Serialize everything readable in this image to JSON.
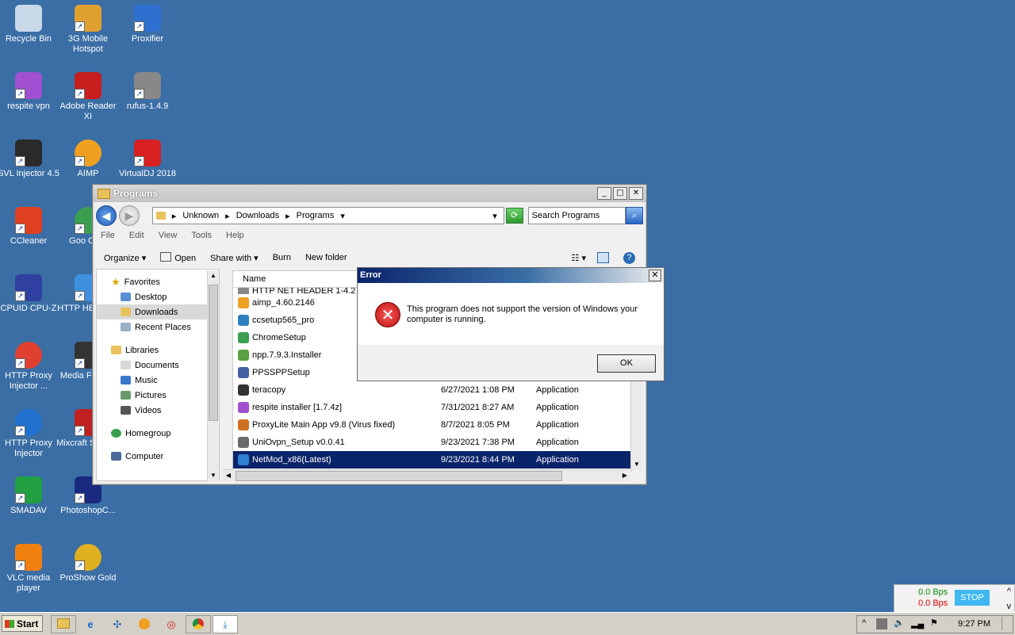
{
  "desktop": {
    "icons": [
      {
        "label": "Recycle Bin",
        "color": "#c8d8e8"
      },
      {
        "label": "3G Mobile Hotspot",
        "color": "#e0a030"
      },
      {
        "label": "Proxifier",
        "color": "#2f6fd0"
      },
      {
        "label": "respite vpn",
        "color": "#a050d0"
      },
      {
        "label": "Adobe Reader XI",
        "color": "#c81e1e"
      },
      {
        "label": "rufus-1.4.9",
        "color": "#888888"
      },
      {
        "label": "SVL Injector 4.5",
        "color": "#2a2a2a"
      },
      {
        "label": "AIMP",
        "color": "#f0a020"
      },
      {
        "label": "VirtualDJ 2018",
        "color": "#d82020"
      },
      {
        "label": "CCleaner",
        "color": "#e04020"
      },
      {
        "label": "Goo Chro",
        "color": "#3aa050"
      },
      {
        "label": "CPUID CPU-Z",
        "color": "#3040a0"
      },
      {
        "label": "HTTP HEADER",
        "color": "#4090e0"
      },
      {
        "label": "HTTP Proxy Injector ...",
        "color": "#e04030"
      },
      {
        "label": "Media F Class",
        "color": "#333333"
      },
      {
        "label": "HTTP Proxy Injector",
        "color": "#2070d0"
      },
      {
        "label": "Mixcraft Studio (",
        "color": "#c02020"
      },
      {
        "label": "SMADAV",
        "color": "#20a040"
      },
      {
        "label": "PhotoshopC...",
        "color": "#1a2a80"
      },
      {
        "label": "VLC media player",
        "color": "#f08010"
      },
      {
        "label": "ProShow Gold",
        "color": "#e0b020"
      }
    ]
  },
  "explorer": {
    "title": "Programs",
    "address": [
      "Unknown",
      "Downloads",
      "Programs"
    ],
    "search_placeholder": "Search Programs",
    "menu": [
      "File",
      "Edit",
      "View",
      "Tools",
      "Help"
    ],
    "toolbar": {
      "organize": "Organize",
      "open": "Open",
      "share": "Share with",
      "burn": "Burn",
      "new_folder": "New folder"
    },
    "nav": {
      "favorites": "Favorites",
      "desktop": "Desktop",
      "downloads": "Downloads",
      "recent": "Recent Places",
      "libraries": "Libraries",
      "documents": "Documents",
      "music": "Music",
      "pictures": "Pictures",
      "videos": "Videos",
      "homegroup": "Homegroup",
      "computer": "Computer"
    },
    "column_name": "Name",
    "files": [
      {
        "name": "HTTP NET HEADER 1-4.2",
        "date": "",
        "type": "",
        "color": "#888"
      },
      {
        "name": "aimp_4.60.2146",
        "date": "",
        "type": "",
        "color": "#f0a020"
      },
      {
        "name": "ccsetup565_pro",
        "date": "",
        "type": "",
        "color": "#2f80c0"
      },
      {
        "name": "ChromeSetup",
        "date": "",
        "type": "",
        "color": "#3aa050"
      },
      {
        "name": "npp.7.9.3.Installer",
        "date": "",
        "type": "",
        "color": "#5aa040"
      },
      {
        "name": "PPSSPPSetup",
        "date": "",
        "type": "",
        "color": "#4060a0"
      },
      {
        "name": "teracopy",
        "date": "6/27/2021 1:08 PM",
        "type": "Application",
        "color": "#333"
      },
      {
        "name": "respite installer [1.7.4z]",
        "date": "7/31/2021 8:27 AM",
        "type": "Application",
        "color": "#a050d0"
      },
      {
        "name": "ProxyLite Main App v9.8 (Virus fixed)",
        "date": "8/7/2021 8:05 PM",
        "type": "Application",
        "color": "#d07020"
      },
      {
        "name": "UniOvpn_Setup v0.0.41",
        "date": "9/23/2021 7:38 PM",
        "type": "Application",
        "color": "#6a6a6a"
      },
      {
        "name": "NetMod_x86(Latest)",
        "date": "9/23/2021 8:44 PM",
        "type": "Application",
        "color": "#2f80d0"
      }
    ]
  },
  "dialog": {
    "title": "Error",
    "message": "This program does not support the version of Windows your computer is running.",
    "ok_label": "OK"
  },
  "netwidget": {
    "up": "0.0 Bps",
    "down": "0.0 Bps",
    "stop": "STOP"
  },
  "taskbar": {
    "start": "Start",
    "clock": "9:27 PM"
  }
}
